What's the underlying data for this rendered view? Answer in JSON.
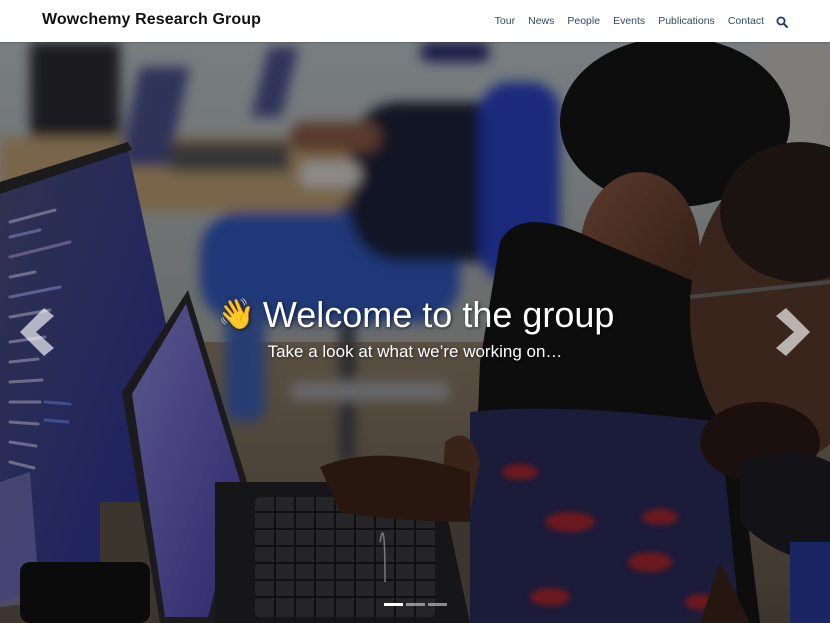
{
  "navbar": {
    "brand": "Wowchemy Research Group",
    "links": [
      {
        "label": "Tour"
      },
      {
        "label": "News"
      },
      {
        "label": "People"
      },
      {
        "label": "Events"
      },
      {
        "label": "Publications"
      },
      {
        "label": "Contact"
      }
    ],
    "search_icon": "search-icon",
    "link_color": "#34495e"
  },
  "hero": {
    "title_emoji": "👋",
    "title": "Welcome to the group",
    "subtitle": "Take a look at what we’re working on…",
    "prev_icon": "chevron-left-icon",
    "next_icon": "chevron-right-icon",
    "slides": {
      "count": 3,
      "active_index": 0
    }
  }
}
